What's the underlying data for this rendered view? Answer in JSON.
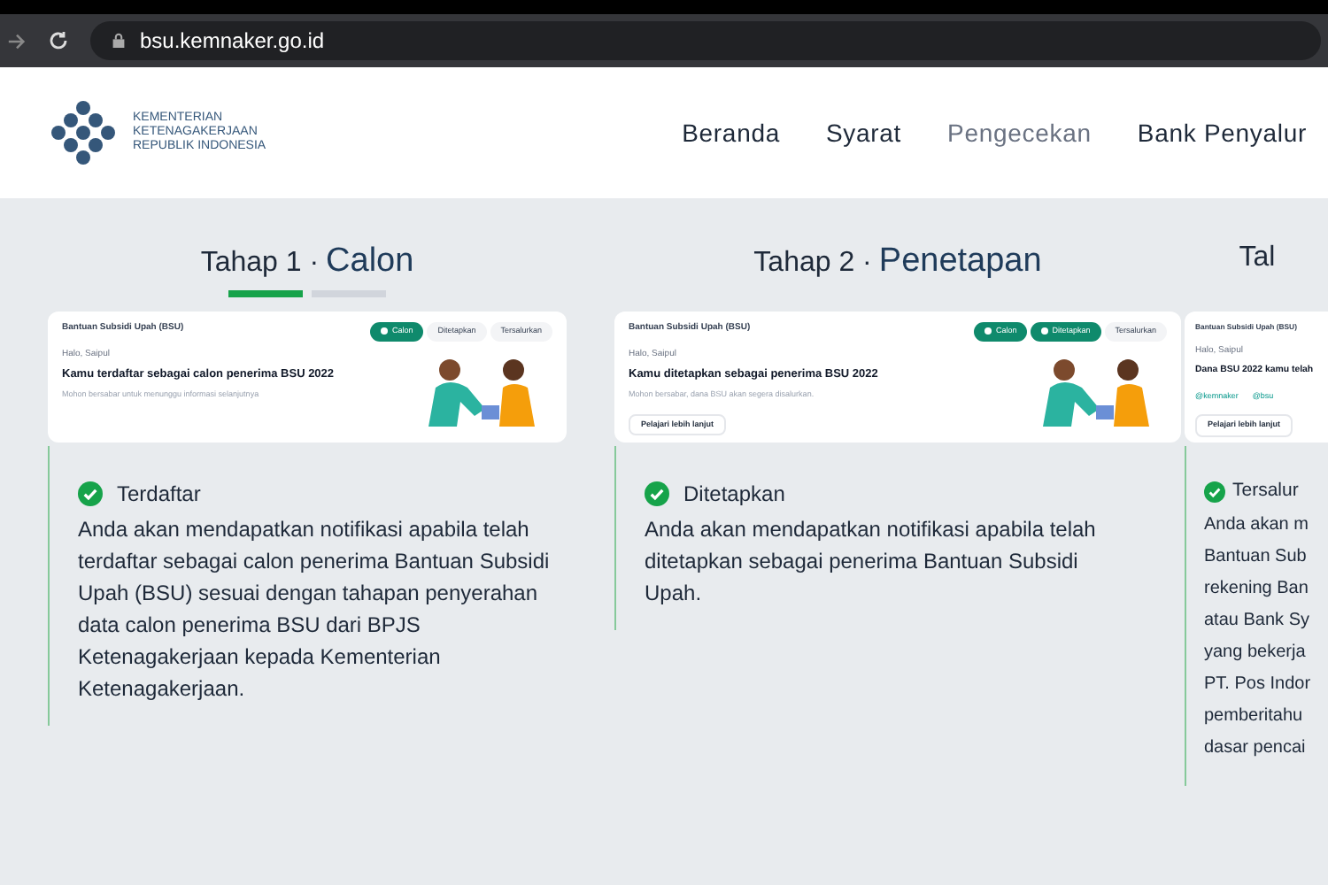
{
  "browser": {
    "url": "bsu.kemnaker.go.id"
  },
  "header": {
    "logo_lines": [
      "KEMENTERIAN",
      "KETENAGAKERJAAN",
      "REPUBLIK INDONESIA"
    ],
    "nav": [
      {
        "label": "Beranda",
        "selected": false
      },
      {
        "label": "Syarat",
        "selected": false
      },
      {
        "label": "Pengecekan",
        "selected": true
      },
      {
        "label": "Bank Penyalur",
        "selected": false
      }
    ]
  },
  "stages": [
    {
      "step": "Tahap 1 ·",
      "name": "Calon",
      "progress": [
        {
          "selected": true
        },
        {
          "selected": false
        }
      ],
      "card": {
        "app": "Bantuan Subsidi Upah (BSU)",
        "greeting": "Halo, Saipul",
        "headline": "Kamu terdaftar sebagai calon penerima BSU 2022",
        "note": "Mohon bersabar untuk menunggu informasi selanjutnya",
        "steps": [
          {
            "label": "Calon",
            "done": true
          },
          {
            "label": "Ditetapkan",
            "done": false
          },
          {
            "label": "Tersalurkan",
            "done": false
          }
        ]
      },
      "status": "Terdaftar",
      "lines": [
        "Anda akan mendapatkan notifikasi apabila telah",
        "terdaftar sebagai calon penerima Bantuan Subsidi",
        "Upah (BSU) sesuai dengan tahapan penyerahan",
        "data calon penerima BSU dari BPJS",
        "Ketenagakerjaan kepada Kementerian",
        "Ketenagakerjaan."
      ]
    },
    {
      "step": "Tahap 2 ·",
      "name": "Penetapan",
      "card": {
        "app": "Bantuan Subsidi Upah (BSU)",
        "greeting": "Halo, Saipul",
        "headline": "Kamu ditetapkan sebagai penerima BSU 2022",
        "note": "Mohon bersabar, dana BSU akan segera disalurkan.",
        "button": "Pelajari lebih lanjut",
        "steps": [
          {
            "label": "Calon",
            "done": true
          },
          {
            "label": "Ditetapkan",
            "done": true
          },
          {
            "label": "Tersalurkan",
            "done": false
          }
        ]
      },
      "status": "Ditetapkan",
      "lines": [
        "Anda akan mendapatkan notifikasi apabila telah",
        "ditetapkan sebagai penerima Bantuan Subsidi",
        "Upah."
      ]
    },
    {
      "step": "Tal",
      "card": {
        "app": "Bantuan Subsidi Upah (BSU)",
        "greeting": "Halo, Saipul",
        "headline": "Dana BSU 2022 kamu telah",
        "handles": [
          "@kemnaker",
          "@bsu"
        ],
        "button": "Pelajari lebih lanjut"
      },
      "status": "Tersalur",
      "lines": [
        "Anda akan m",
        "Bantuan Sub",
        "rekening Ban",
        "atau Bank Sy",
        "yang bekerja",
        "PT. Pos Indor",
        "pemberitahu",
        "dasar pencai"
      ]
    }
  ]
}
